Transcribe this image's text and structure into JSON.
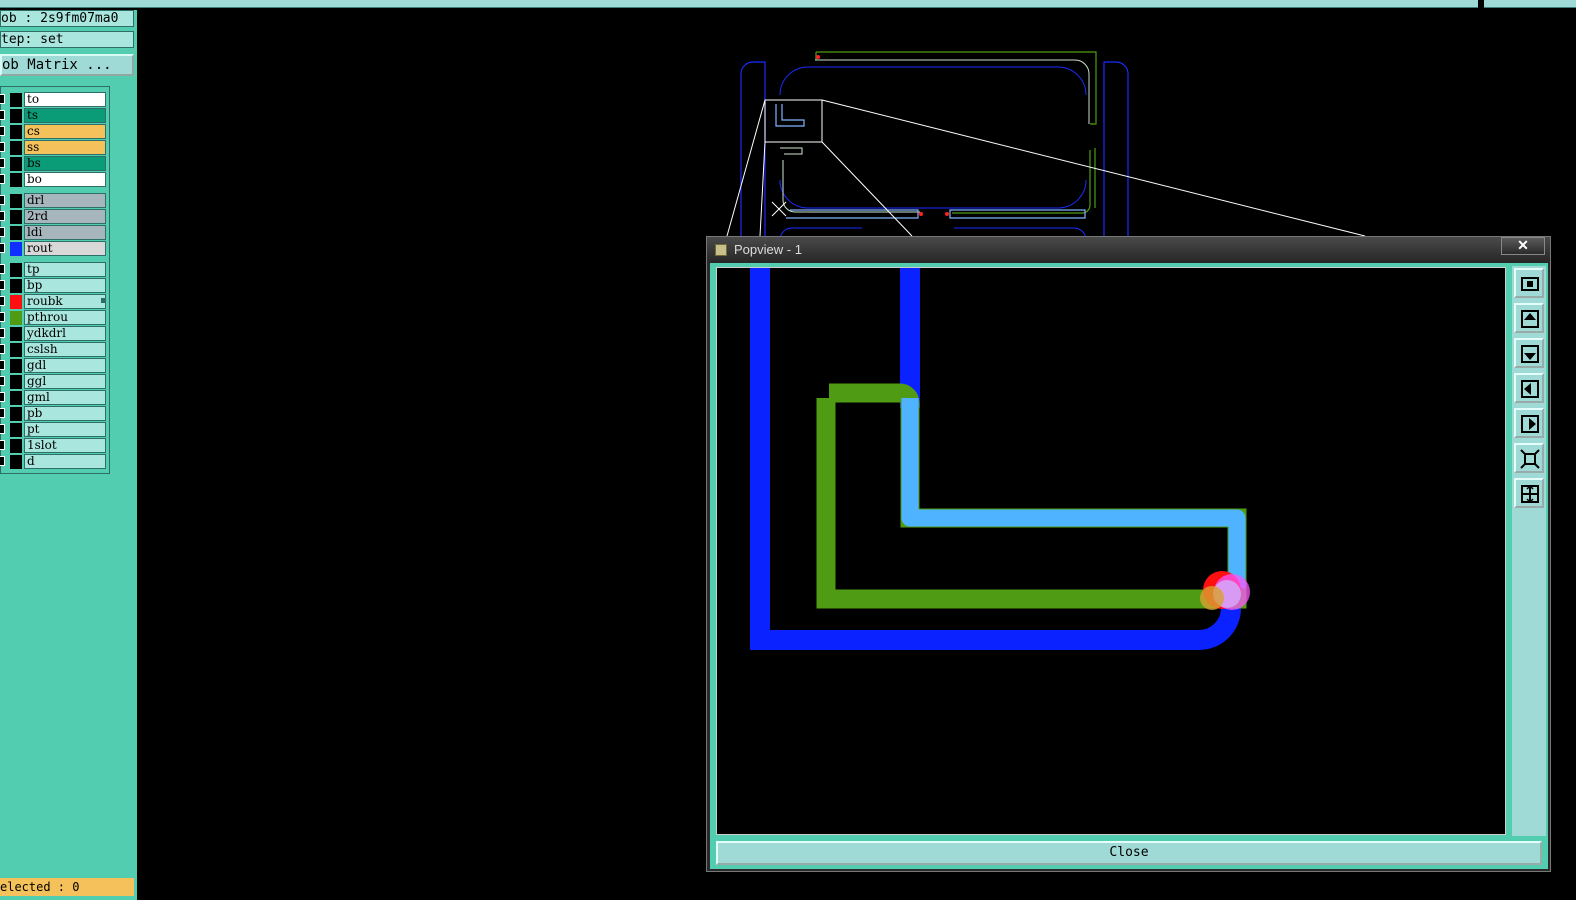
{
  "info": {
    "job": "ob : 2s9fm07ma0",
    "step": "tep: set",
    "matrix_button": "ob Matrix ..."
  },
  "layers": [
    {
      "name": "to",
      "color": "#ffffff",
      "swatch": "#000000"
    },
    {
      "name": "ts",
      "color": "#0a9c77",
      "swatch": "#000000"
    },
    {
      "name": "cs",
      "color": "#f5c15a",
      "swatch": "#000000"
    },
    {
      "name": "ss",
      "color": "#f5c15a",
      "swatch": "#000000"
    },
    {
      "name": "bs",
      "color": "#0a9c77",
      "swatch": "#000000"
    },
    {
      "name": "bo",
      "color": "#ffffff",
      "swatch": "#000000"
    },
    {
      "name": "drl",
      "color": "#a7b5bd",
      "swatch": "#000000"
    },
    {
      "name": "2rd",
      "color": "#a7b5bd",
      "swatch": "#000000"
    },
    {
      "name": "ldi",
      "color": "#a7b5bd",
      "swatch": "#000000"
    },
    {
      "name": "rout",
      "color": "#d8d8d8",
      "swatch": "#1030ff"
    },
    {
      "name": "tp",
      "color": "#a9e6de",
      "swatch": "#000000"
    },
    {
      "name": "bp",
      "color": "#a9e6de",
      "swatch": "#000000"
    },
    {
      "name": "roubk",
      "color": "#a9e6de",
      "swatch": "#ff1010"
    },
    {
      "name": "pthrou",
      "color": "#a9e6de",
      "swatch": "#4f9b14"
    },
    {
      "name": "ydkdrl",
      "color": "#a9e6de",
      "swatch": "#000000"
    },
    {
      "name": "cslsh",
      "color": "#a9e6de",
      "swatch": "#000000"
    },
    {
      "name": "gdl",
      "color": "#a9e6de",
      "swatch": "#000000"
    },
    {
      "name": "ggl",
      "color": "#a9e6de",
      "swatch": "#000000"
    },
    {
      "name": "gml",
      "color": "#a9e6de",
      "swatch": "#000000"
    },
    {
      "name": "pb",
      "color": "#a9e6de",
      "swatch": "#000000"
    },
    {
      "name": "pt",
      "color": "#a9e6de",
      "swatch": "#000000"
    },
    {
      "name": "1slot",
      "color": "#a9e6de",
      "swatch": "#000000"
    },
    {
      "name": "d",
      "color": "#a9e6de",
      "swatch": "#000000"
    }
  ],
  "status": {
    "selected": "elected : 0"
  },
  "popview": {
    "title": "Popview - 1",
    "close_x": "✕",
    "close_button": "Close",
    "tools": [
      "zoom-fit-icon",
      "pan-up-icon",
      "pan-down-icon",
      "pan-left-icon",
      "pan-right-icon",
      "zoom-in-icon",
      "zoom-out-icon"
    ]
  },
  "colors": {
    "panel": "#52cdb0",
    "rout": "#1030ff",
    "pthrou": "#4f9b14",
    "lightblue": "#4fb3ff",
    "roubk": "#ff1010"
  }
}
